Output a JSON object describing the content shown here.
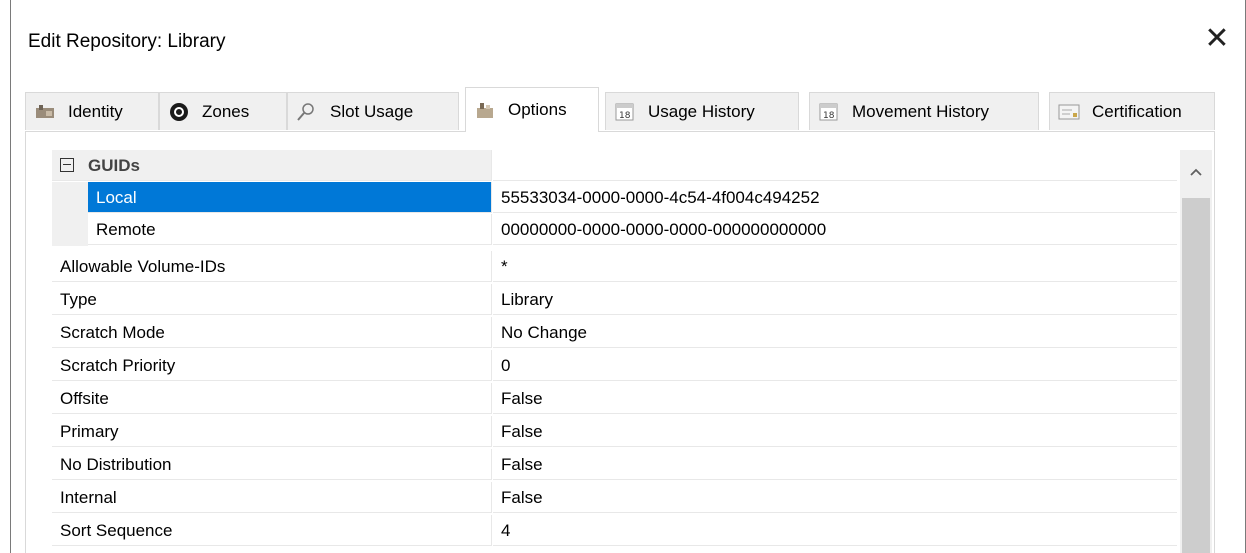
{
  "window": {
    "title": "Edit Repository: Library",
    "close_glyph": "✕"
  },
  "tabs": [
    {
      "label": "Identity",
      "icon": "identity-icon",
      "active": false
    },
    {
      "label": "Zones",
      "icon": "zones-icon",
      "active": false
    },
    {
      "label": "Slot Usage",
      "icon": "magnifier-icon",
      "active": false
    },
    {
      "label": "Options",
      "icon": "options-icon",
      "active": true
    },
    {
      "label": "Usage History",
      "icon": "calendar-icon",
      "active": false
    },
    {
      "label": "Movement History",
      "icon": "calendar-icon",
      "active": false
    },
    {
      "label": "Certification",
      "icon": "certificate-icon",
      "active": false
    }
  ],
  "grid": {
    "category": {
      "label": "GUIDs",
      "expanded": true
    },
    "guid_rows": [
      {
        "name": "Local",
        "value": "55533034-0000-0000-4c54-4f004c494252",
        "selected": true
      },
      {
        "name": "Remote",
        "value": "00000000-0000-0000-0000-000000000000",
        "selected": false
      }
    ],
    "rows": [
      {
        "name": "Allowable Volume-IDs",
        "value": "*"
      },
      {
        "name": "Type",
        "value": "Library"
      },
      {
        "name": "Scratch Mode",
        "value": "No Change"
      },
      {
        "name": "Scratch Priority",
        "value": "0"
      },
      {
        "name": "Offsite",
        "value": "False"
      },
      {
        "name": "Primary",
        "value": "False"
      },
      {
        "name": "No Distribution",
        "value": "False"
      },
      {
        "name": "Internal",
        "value": "False"
      },
      {
        "name": "Sort Sequence",
        "value": "4"
      }
    ]
  },
  "scrollbar": {
    "up_glyph": "^"
  },
  "colors": {
    "selection": "#0078d7",
    "category_bg": "#f0f0f0"
  }
}
